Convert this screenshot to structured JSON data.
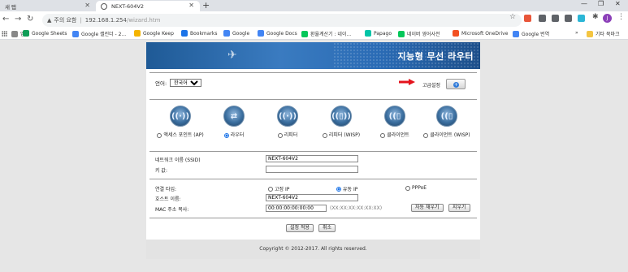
{
  "browser": {
    "tabs": [
      {
        "label": "새 탭",
        "close": "✕"
      },
      {
        "label": "NEXT-604V2",
        "close": "✕"
      }
    ],
    "new_tab": "+",
    "window_controls": [
      "—",
      "❐",
      "✕"
    ],
    "security_label": "주의 요함",
    "url_host": "192.168.1.254",
    "url_path": "/wizard.htm",
    "profile_initial": "J",
    "bookmarks": [
      {
        "label": "앱",
        "color": "#888888"
      },
      {
        "label": "Google Sheets",
        "color": "#0f9d58"
      },
      {
        "label": "Google 캘린더 - 2...",
        "color": "#4285f4"
      },
      {
        "label": "Google Keep",
        "color": "#f4b400"
      },
      {
        "label": "Bookmarks",
        "color": "#1a73e8"
      },
      {
        "label": "Google",
        "color": "#4285f4"
      },
      {
        "label": "Google Docs",
        "color": "#4285f4"
      },
      {
        "label": "환율계산기 : 네이...",
        "color": "#03c75a"
      },
      {
        "label": "Papago",
        "color": "#00c4a7"
      },
      {
        "label": "네이버 영어사전",
        "color": "#03c75a"
      },
      {
        "label": "Microsoft OneDrive",
        "color": "#f25022"
      },
      {
        "label": "Google 번역",
        "color": "#4285f4"
      }
    ],
    "bookmarks_more": "»",
    "other_bookmarks": "기타 북마크"
  },
  "banner": {
    "title": "지능형 무선 라우터"
  },
  "language": {
    "label": "언어:",
    "selected": "한국어"
  },
  "advanced": {
    "label": "고급설정",
    "button_glyph": "+"
  },
  "modes": [
    {
      "label": "액세스 포인트 (AP)",
      "checked": false,
      "icon": "ap-mode-icon",
      "glyph": "((·))"
    },
    {
      "label": "라우터",
      "checked": true,
      "icon": "router-mode-icon",
      "glyph": "⇄"
    },
    {
      "label": "리피터",
      "checked": false,
      "icon": "repeater-mode-icon",
      "glyph": "((·))"
    },
    {
      "label": "리피터 (WISP)",
      "checked": false,
      "icon": "wisp-repeater-mode-icon",
      "glyph": "((▯))"
    },
    {
      "label": "클라이언트",
      "checked": false,
      "icon": "client-mode-icon",
      "glyph": "((▯"
    },
    {
      "label": "클라이언트 (WISP)",
      "checked": false,
      "icon": "wisp-client-mode-icon",
      "glyph": "((▯"
    }
  ],
  "wireless": {
    "ssid_label": "네트워크 이름 (SSID)",
    "ssid_value": "NEXT-604V2",
    "key_label": "키 값:",
    "key_value": ""
  },
  "connection": {
    "type_label": "연결 타입:",
    "options": [
      {
        "label": "고정 IP",
        "checked": false
      },
      {
        "label": "유동 IP",
        "checked": true
      },
      {
        "label": "PPPoE",
        "checked": false
      }
    ],
    "host_label": "호스트 이름:",
    "host_value": "NEXT-604V2",
    "mac_label": "MAC 주소 복사:",
    "mac_value": "00:00:00:00:00:00",
    "mac_hint": "(XX:XX:XX:XX:XX:XX)",
    "auto_fill": "자동 채우기",
    "clear": "지우기"
  },
  "actions": {
    "apply": "설정 적용",
    "cancel": "취소"
  },
  "footer": {
    "copyright": "Copyright © 2012-2017. All rights reserved."
  }
}
